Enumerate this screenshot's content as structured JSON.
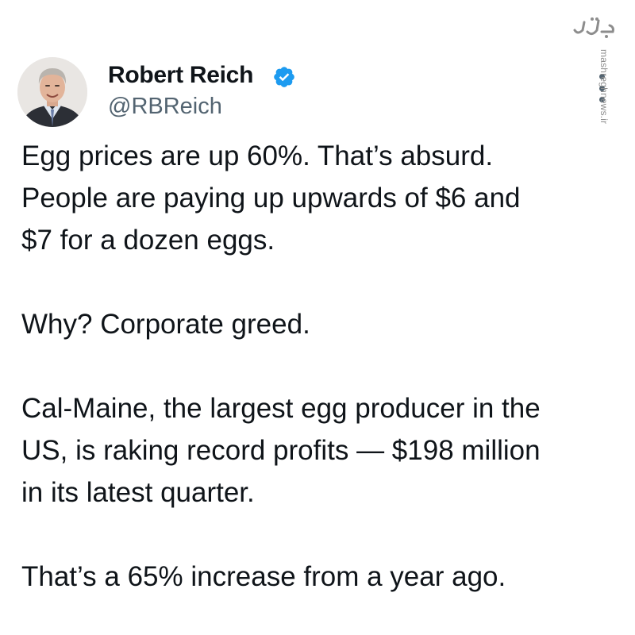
{
  "author": {
    "display_name": "Robert Reich",
    "handle": "@RBReich",
    "verified_badge_color": "#1d9bf0",
    "verified_icon": "verified-badge-icon",
    "avatar_icon": "profile-photo"
  },
  "menu": {
    "icon": "more-options-icon"
  },
  "watermark": {
    "logo_text": "مشرق",
    "url": "mashreghnews.ir",
    "color": "#8d8d8d"
  },
  "tweet": {
    "paragraphs": [
      {
        "lines": [
          "Egg prices are up 60%. That’s absurd.",
          "People are paying up upwards of $6 and",
          "$7 for a dozen eggs."
        ]
      },
      {
        "lines": [
          "Why? Corporate greed."
        ]
      },
      {
        "lines": [
          "Cal-Maine, the largest egg producer in the",
          "US, is raking record profits — $198 million",
          "in its latest quarter."
        ]
      },
      {
        "lines": [
          "That’s a 65% increase from a year ago."
        ]
      }
    ]
  }
}
